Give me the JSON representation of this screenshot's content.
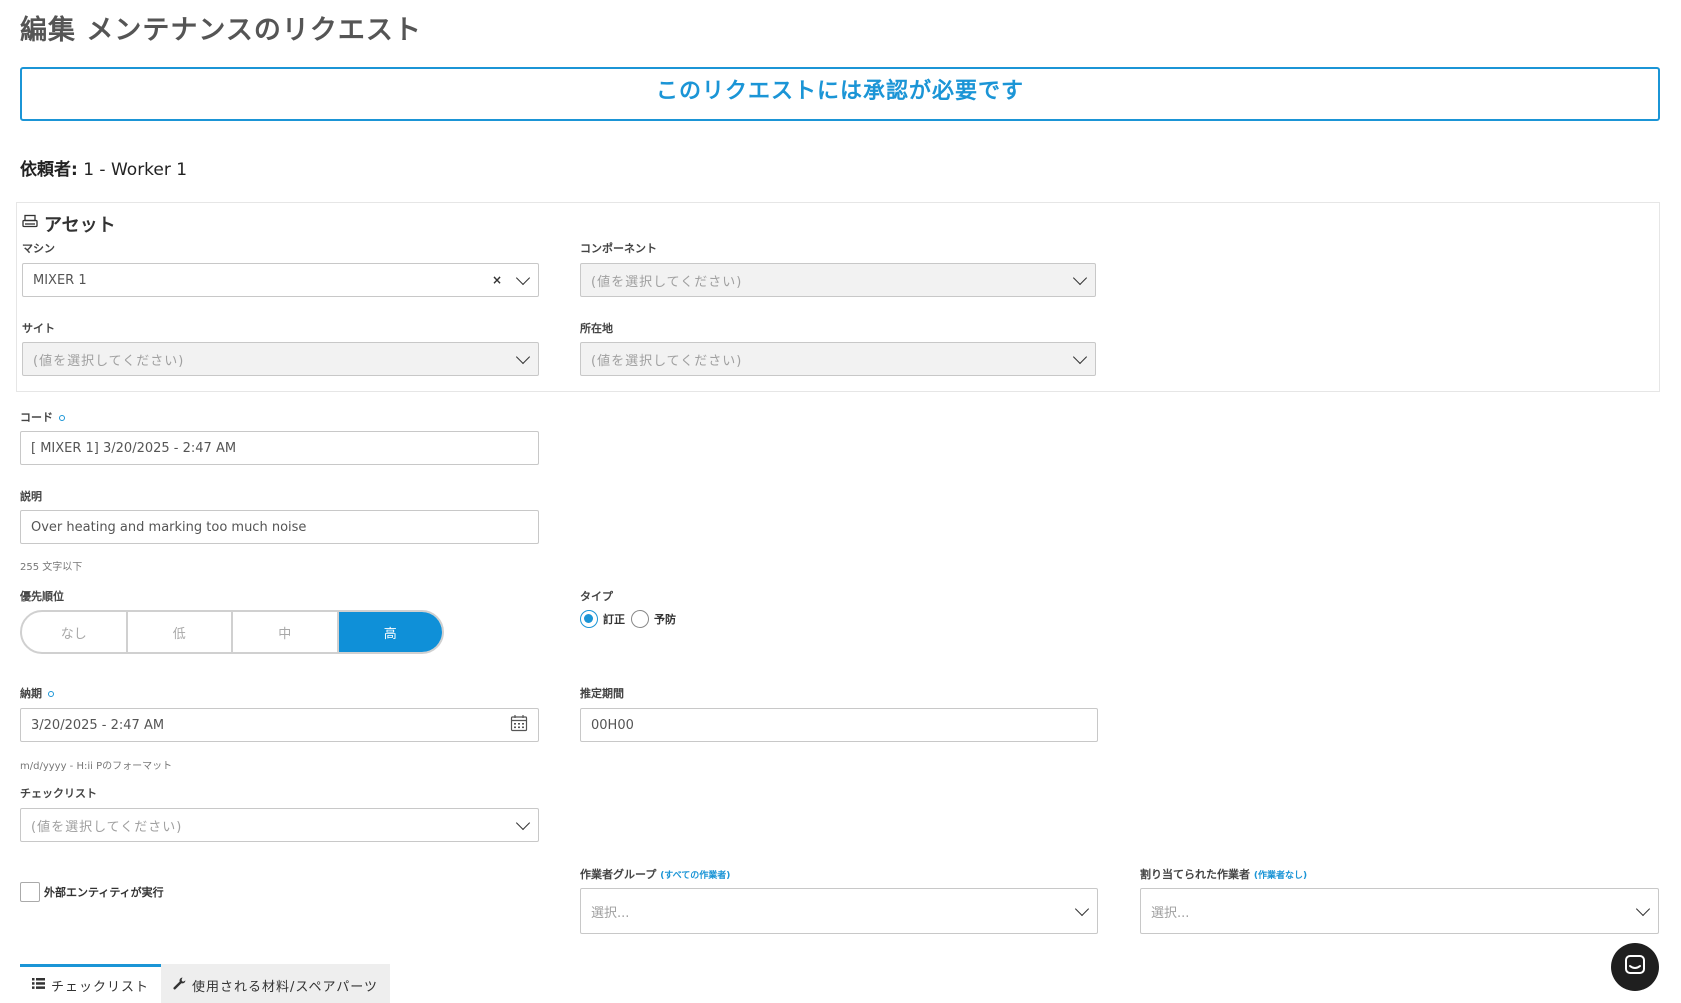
{
  "page": {
    "title": "編集 メンテナンスのリクエスト"
  },
  "banner": {
    "text": "このリクエストには承認が必要です"
  },
  "requester": {
    "label": "依頼者:",
    "value": " 1 - Worker 1"
  },
  "asset": {
    "header": "アセット",
    "machine": {
      "label": "マシン",
      "value": "MIXER 1",
      "clear_icon": "×"
    },
    "component": {
      "label": "コンポーネント",
      "placeholder": "(値を選択してください)"
    },
    "site": {
      "label": "サイト",
      "placeholder": "(値を選択してください)"
    },
    "location": {
      "label": "所在地",
      "placeholder": "(値を選択してください)"
    }
  },
  "code": {
    "label": "コード",
    "value": "[ MIXER 1] 3/20/2025 - 2:47 AM"
  },
  "description": {
    "label": "説明",
    "value": "Over heating and marking too much noise",
    "hint": "255 文字以下"
  },
  "priority": {
    "label": "優先順位",
    "options": [
      "なし",
      "低",
      "中",
      "高"
    ],
    "selected": "高"
  },
  "type": {
    "label": "タイプ",
    "options": [
      "訂正",
      "予防"
    ],
    "selected": "訂正"
  },
  "due_date": {
    "label": "納期",
    "value": "3/20/2025 - 2:47 AM",
    "hint": "m/d/yyyy - H:ii Pのフォーマット"
  },
  "estimated_duration": {
    "label": "推定期間",
    "value": "00H00"
  },
  "checklist": {
    "label": "チェックリスト",
    "placeholder": "(値を選択してください)"
  },
  "external": {
    "label": "外部エンティティが実行"
  },
  "worker_group": {
    "label": "作業者グループ",
    "link": "(すべての作業者)",
    "placeholder": "選択..."
  },
  "assigned_worker": {
    "label": "割り当てられた作業者",
    "link": "(作業者なし)",
    "placeholder": "選択..."
  },
  "tabs": [
    {
      "label": "チェックリスト",
      "icon": "list-icon"
    },
    {
      "label": "使用される材料/スペアパーツ",
      "icon": "wrench-icon"
    }
  ],
  "colors": {
    "accent": "#1b95d6",
    "active_segment": "#0f90d8",
    "chat_button": "#1f1f1f"
  }
}
